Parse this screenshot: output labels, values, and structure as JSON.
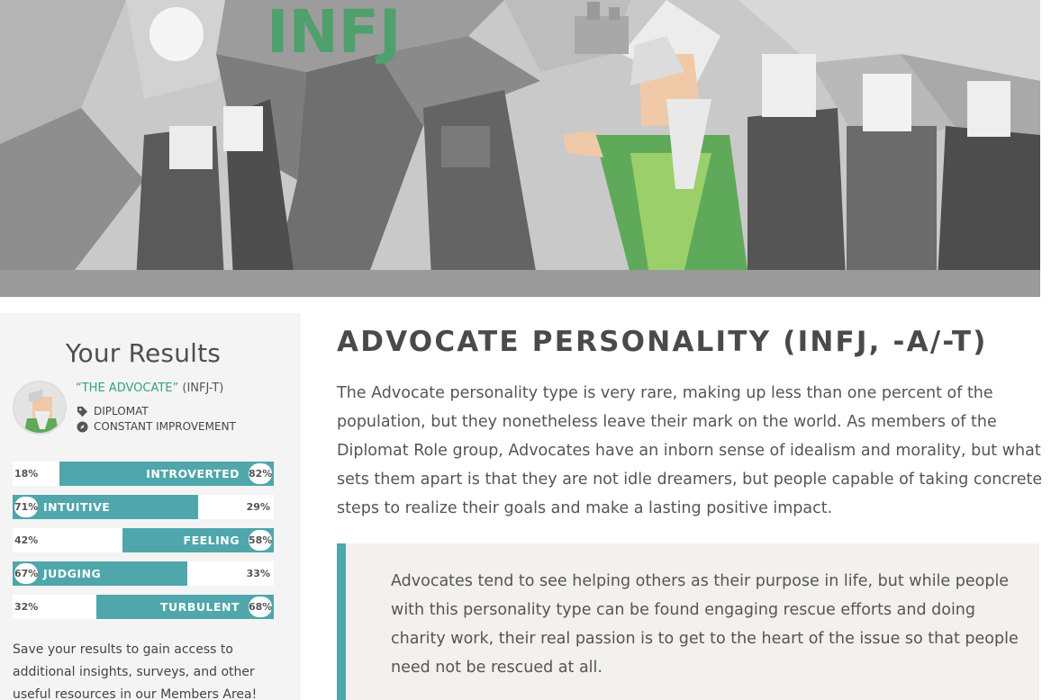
{
  "hero": {
    "sign_text": "INFJ"
  },
  "sidebar": {
    "title": "Your Results",
    "type_name": "“THE ADVOCATE”",
    "type_code": " (INFJ-T)",
    "role": "DIPLOMAT",
    "strategy": "CONSTANT IMPROVEMENT",
    "traits": [
      {
        "left_pct": "18%",
        "label": "INTROVERTED",
        "right_pct": "82%",
        "fill_fraction": 0.82,
        "side": "right"
      },
      {
        "left_pct": "71%",
        "label": "INTUITIVE",
        "right_pct": "29%",
        "fill_fraction": 0.71,
        "side": "left"
      },
      {
        "left_pct": "42%",
        "label": "FEELING",
        "right_pct": "58%",
        "fill_fraction": 0.58,
        "side": "right"
      },
      {
        "left_pct": "67%",
        "label": "JUDGING",
        "right_pct": "33%",
        "fill_fraction": 0.67,
        "side": "left"
      },
      {
        "left_pct": "32%",
        "label": "TURBULENT",
        "right_pct": "68%",
        "fill_fraction": 0.68,
        "side": "right"
      }
    ],
    "save_text": "Save your results to gain access to additional insights, surveys, and other useful resources in our Members Area!"
  },
  "main": {
    "title": "ADVOCATE PERSONALITY (INFJ, -A/-T)",
    "paragraph": "The Advocate personality type is very rare, making up less than one percent of the population, but they nonetheless leave their mark on the world. As members of the Diplomat Role group, Advocates have an inborn sense of idealism and morality, but what sets them apart is that they are not idle dreamers, but people capable of taking concrete steps to realize their goals and make a lasting positive impact.",
    "quote": "Advocates tend to see helping others as their purpose in life, but while people with this personality type can be found engaging rescue efforts and doing charity work, their real passion is to get to the heart of the issue so that people need not be rescued at all."
  },
  "colors": {
    "accent": "#4fa7ac",
    "green": "#33a474",
    "sidebar_bg": "#f4f4f4",
    "quote_bg": "#f2f1ef"
  },
  "icons": {
    "role": "tag-icon",
    "strategy": "compass-icon"
  }
}
